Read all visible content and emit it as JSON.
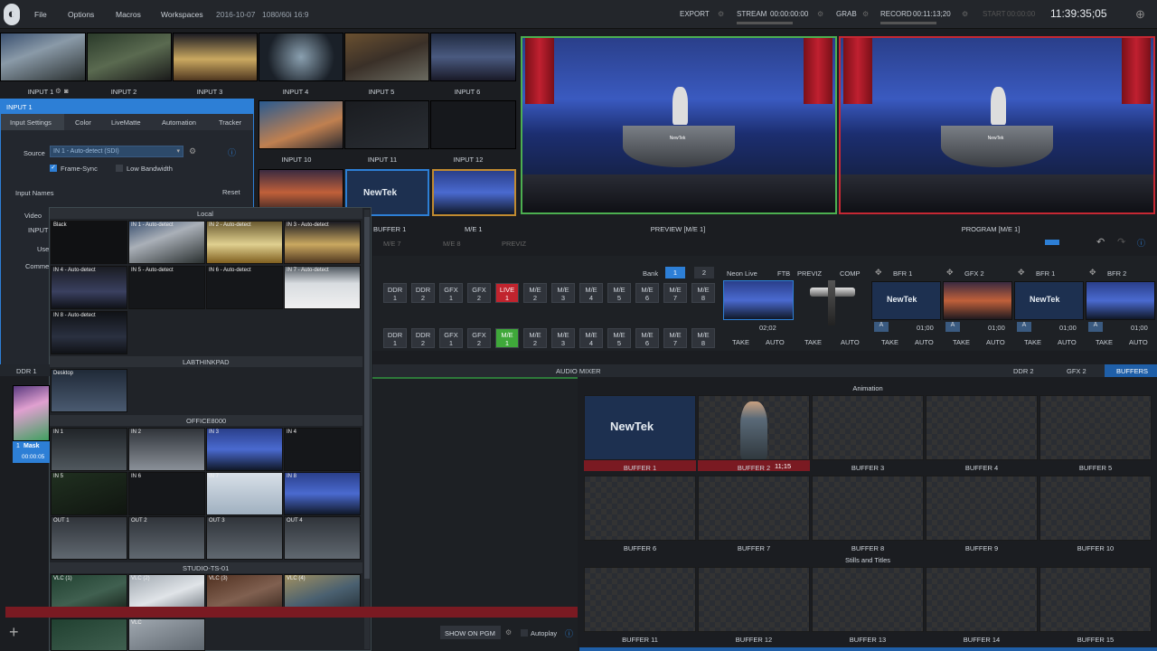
{
  "menu": {
    "file": "File",
    "options": "Options",
    "macros": "Macros",
    "workspaces": "Workspaces",
    "date": "2016-10-07",
    "format": "1080/60i 16:9"
  },
  "toolbar": {
    "export": "EXPORT",
    "stream": "STREAM",
    "stream_time": "00:00:00:00",
    "grab": "GRAB",
    "record": "RECORD",
    "record_time": "00:11:13;20",
    "start": "START",
    "start_time": "00:00:00",
    "clock": "11:39:35;05"
  },
  "inputs": [
    {
      "label": "INPUT 1"
    },
    {
      "label": "INPUT 2"
    },
    {
      "label": "INPUT 3"
    },
    {
      "label": "INPUT 4"
    },
    {
      "label": "INPUT 5"
    },
    {
      "label": "INPUT 6"
    },
    {
      "label": "INPUT 10"
    },
    {
      "label": "INPUT 11"
    },
    {
      "label": "INPUT 12"
    }
  ],
  "newtek": "NewTek",
  "input_panel": {
    "title": "INPUT 1",
    "tabs": [
      "Input Settings",
      "Color",
      "LiveMatte",
      "Automation",
      "Tracker"
    ],
    "source_label": "Source",
    "source_value": "IN 1 - Auto-detect (SDI)",
    "frame_sync": "Frame-Sync",
    "low_bandwidth": "Low Bandwidth",
    "input_names": "Input Names",
    "reset": "Reset",
    "video": "Video",
    "input_short": "INPUT",
    "use": "Use",
    "comm": "Comme"
  },
  "source_browser": {
    "sections": [
      {
        "title": "Local",
        "items": [
          "Black",
          "IN 1 - Auto-detect",
          "IN 2 - Auto-detect",
          "IN 3 - Auto-detect",
          "IN 4 - Auto-detect",
          "IN 5 - Auto-detect",
          "IN 6 - Auto-detect",
          "IN 7 - Auto-detect",
          "IN 8 - Auto-detect"
        ]
      },
      {
        "title": "LABTHINKPAD",
        "items": [
          "Desktop"
        ]
      },
      {
        "title": "OFFICE8000",
        "items": [
          "IN 1",
          "IN 2",
          "IN 3",
          "IN 4",
          "IN 5",
          "IN 6",
          "IN 7",
          "IN 8",
          "OUT 1",
          "OUT 2",
          "OUT 3",
          "OUT 4"
        ]
      },
      {
        "title": "STUDIO-TS-01",
        "items": [
          "VLC (1)",
          "VLC (2)",
          "VLC (3)",
          "VLC (4)",
          "VLC"
        ]
      }
    ]
  },
  "ddr1": {
    "label": "DDR 1",
    "clip": "Mask",
    "clip_num": "1",
    "time": "00:00:05"
  },
  "monitors": {
    "preview": "PREVIEW [M/E 1]",
    "program": "PROGRAM [M/E 1]",
    "buffer1": "BUFFER 1",
    "me1": "M/E 1",
    "me_tabs": [
      "M/E 7",
      "M/E 8",
      "PREVIZ"
    ]
  },
  "switcher": {
    "bank": "Bank",
    "bank1": "1",
    "bank2": "2",
    "row1": [
      {
        "a": "DDR",
        "b": "1"
      },
      {
        "a": "DDR",
        "b": "2"
      },
      {
        "a": "GFX",
        "b": "1"
      },
      {
        "a": "GFX",
        "b": "2"
      },
      {
        "a": "LIVE",
        "b": "1"
      },
      {
        "a": "M/E",
        "b": "2"
      },
      {
        "a": "M/E",
        "b": "3"
      },
      {
        "a": "M/E",
        "b": "4"
      },
      {
        "a": "M/E",
        "b": "5"
      },
      {
        "a": "M/E",
        "b": "6"
      },
      {
        "a": "M/E",
        "b": "7"
      },
      {
        "a": "M/E",
        "b": "8"
      }
    ],
    "row2": [
      {
        "a": "DDR",
        "b": "1"
      },
      {
        "a": "DDR",
        "b": "2"
      },
      {
        "a": "GFX",
        "b": "1"
      },
      {
        "a": "GFX",
        "b": "2"
      },
      {
        "a": "M/E",
        "b": "1"
      },
      {
        "a": "M/E",
        "b": "2"
      },
      {
        "a": "M/E",
        "b": "3"
      },
      {
        "a": "M/E",
        "b": "4"
      },
      {
        "a": "M/E",
        "b": "5"
      },
      {
        "a": "M/E",
        "b": "6"
      },
      {
        "a": "M/E",
        "b": "7"
      },
      {
        "a": "M/E",
        "b": "8"
      }
    ],
    "neon_live": "Neon Live",
    "ftb": "FTB",
    "previz": "PREVIZ",
    "comp": "COMP",
    "neon_time": "02;02",
    "take": "TAKE",
    "auto": "AUTO",
    "dsk": [
      {
        "label": "BFR 1",
        "time": "01;00"
      },
      {
        "label": "GFX 2",
        "time": "01;00"
      },
      {
        "label": "BFR 1",
        "time": "01;00"
      },
      {
        "label": "BFR 2",
        "time": "01;00"
      }
    ]
  },
  "tabs_bottom": {
    "audio_mixer": "AUDIO MIXER",
    "ddr2": "DDR 2",
    "gfx2": "GFX 2",
    "buffers": "BUFFERS",
    "show_on_pgm": "SHOW ON PGM",
    "autoplay": "Autoplay"
  },
  "buffers": {
    "animation": "Animation",
    "stills": "Stills and Titles",
    "buffer2_time": "11;15",
    "names": [
      "BUFFER 1",
      "BUFFER 2",
      "BUFFER 3",
      "BUFFER 4",
      "BUFFER 5",
      "BUFFER 6",
      "BUFFER 7",
      "BUFFER 8",
      "BUFFER 9",
      "BUFFER 10",
      "BUFFER 11",
      "BUFFER 12",
      "BUFFER 13",
      "BUFFER 14",
      "BUFFER 15"
    ]
  },
  "colors": {
    "accent": "#2d7fd6",
    "red": "#c1242e",
    "green": "#3fa83a",
    "preview_border": "#4caf50",
    "program_border": "#c62833"
  }
}
